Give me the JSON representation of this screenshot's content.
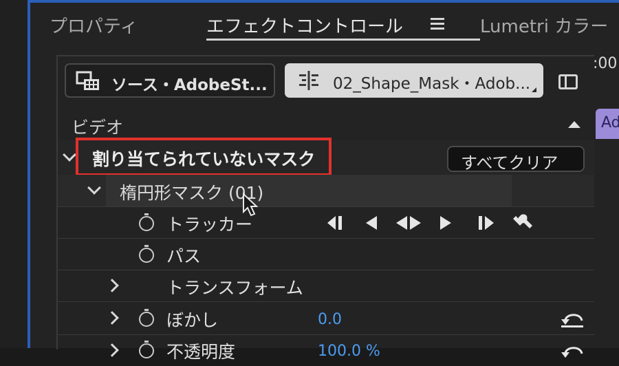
{
  "tabs": {
    "properties": "プロパティ",
    "effect_controls": "エフェクトコントロール",
    "lumetri": "Lumetri カラー"
  },
  "source": {
    "label": "ソース・AdobeSt..."
  },
  "clip": {
    "label": "02_Shape_Mask・Adob..."
  },
  "sections": {
    "video": "ビデオ",
    "unassigned_masks": "割り当てられていないマスク",
    "clear_all": "すべてクリア"
  },
  "mask": {
    "name": "楕円形マスク (01)",
    "tracker": "トラッカー",
    "path": "パス",
    "transform": "トランスフォーム",
    "feather": "ぼかし",
    "feather_value": "0.0",
    "opacity": "不透明度",
    "opacity_value": "100.0 %"
  },
  "timeline": {
    "timecode": ":00",
    "clip_chip": "Ad"
  },
  "colors": {
    "accent_blue": "#2b5fb8",
    "highlight_red": "#e3312c",
    "value_blue": "#4b9cf0",
    "clip_purple": "#9b8bd8"
  },
  "icons": {
    "source": "monitor-grid-icon",
    "clip": "align-center-icon",
    "panel": "panel-toggle-icon",
    "menu": "hamburger-menu-icon",
    "stopwatch": "stopwatch-icon",
    "reset": "reset-icon",
    "wrench": "wrench-icon"
  }
}
